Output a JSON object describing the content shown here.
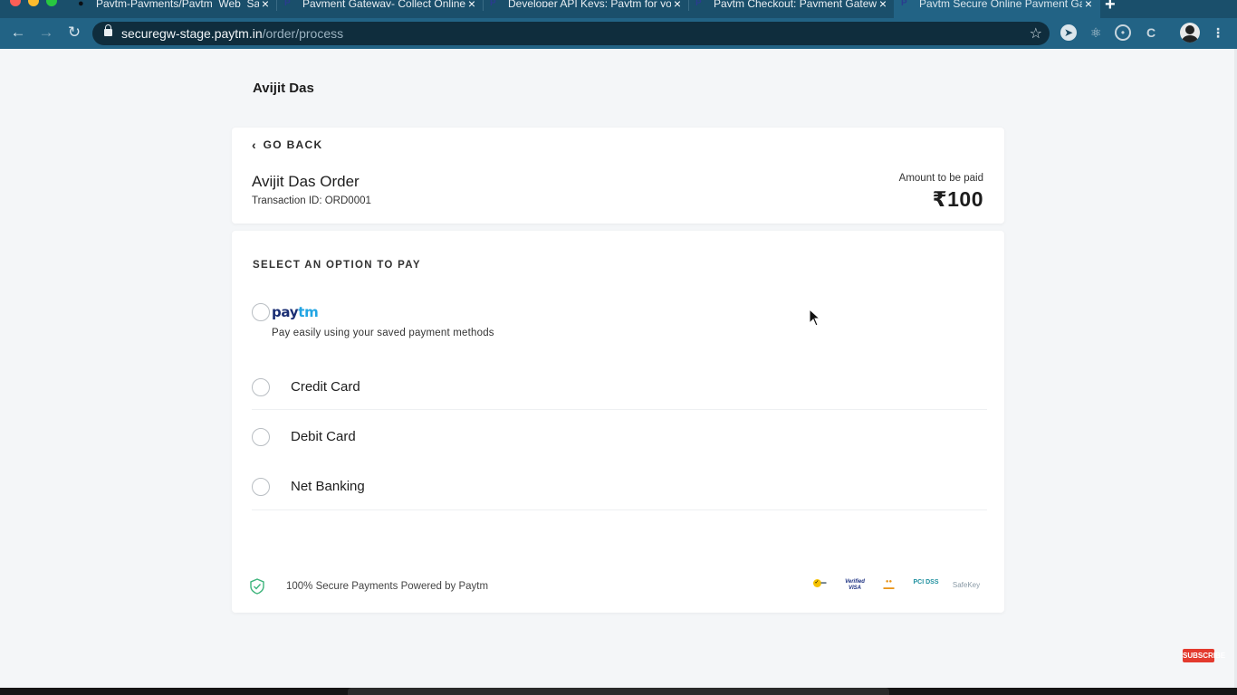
{
  "browser": {
    "tabs": [
      {
        "title": "Paytm-Payments/Paytm_Web_Sample_Kit",
        "icon": "github-icon",
        "active": false
      },
      {
        "title": "Payment Gateway- Collect Online Payments",
        "icon": "paytm-icon",
        "active": false
      },
      {
        "title": "Developer API Keys: Paytm for you",
        "icon": "paytm-icon",
        "active": false
      },
      {
        "title": "Paytm Checkout: Payment Gateway",
        "icon": "paytm-icon",
        "active": false
      },
      {
        "title": "Paytm Secure Online Payment Gateway",
        "icon": "paytm-icon",
        "active": true
      }
    ],
    "new_tab": "+",
    "url_host": "securegw-stage.paytm.in",
    "url_path": "/order/process",
    "extensions": [
      "compass-icon",
      "react-icon",
      "circle-icon",
      "code-icon"
    ],
    "colors": {
      "frame": "#1a4f6b",
      "toolbar": "#226385",
      "omnibox": "#0f2d3d"
    }
  },
  "merchant": {
    "name": "Avijit Das"
  },
  "order": {
    "go_back": "GO BACK",
    "title": "Avijit Das Order",
    "transaction": "Transaction ID: ORD0001",
    "amount_label": "Amount to be paid",
    "amount": "₹100"
  },
  "payment": {
    "heading": "SELECT AN OPTION TO PAY",
    "paytm_logo_part1": "pay",
    "paytm_logo_part2": "tm",
    "paytm_description": "Pay easily using your saved payment methods",
    "options": [
      "Credit Card",
      "Debit Card",
      "Net Banking"
    ]
  },
  "footer": {
    "secure_text": "100% Secure Payments Powered by Paytm",
    "badges": [
      "norton",
      "verified-by-visa",
      "mastercard-securecode",
      "pci-dss",
      "safekey"
    ]
  },
  "colors": {
    "paytm_navy": "#1a2e73",
    "paytm_blue": "#21a5e3",
    "secure_green": "#3bb37a",
    "subscribe_red": "#e33a2e"
  },
  "overlay": {
    "subscribe": "SUBSCRIBE"
  }
}
